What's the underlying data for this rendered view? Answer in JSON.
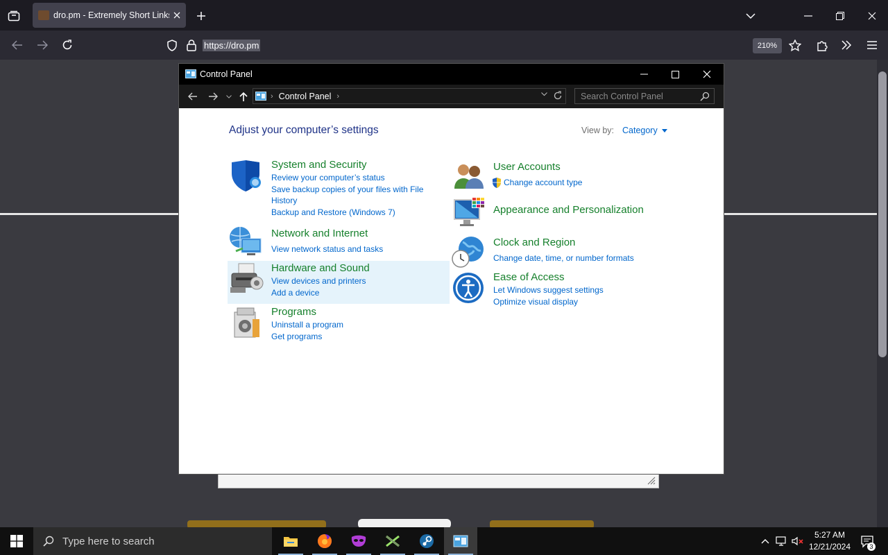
{
  "browser": {
    "tab_title": "dro.pm - Extremely Short Links",
    "url": "https://dro.pm",
    "zoom": "210%"
  },
  "window": {
    "title": "Control Panel",
    "breadcrumb": "Control Panel",
    "search_placeholder": "Search Control Panel"
  },
  "control_panel": {
    "heading": "Adjust your computer’s settings",
    "view_by_label": "View by:",
    "view_by_value": "Category",
    "left": [
      {
        "title": "System and Security",
        "icon": "shield-icon",
        "links": [
          "Review your computer’s status",
          "Save backup copies of your files with File",
          "History",
          "Backup and Restore (Windows 7)"
        ]
      },
      {
        "title": "Network and Internet",
        "icon": "network-icon",
        "links": [
          "View network status and tasks"
        ]
      },
      {
        "title": "Hardware and Sound",
        "icon": "printer-icon",
        "links": [
          "View devices and printers",
          "Add a device"
        ]
      },
      {
        "title": "Programs",
        "icon": "programs-icon",
        "links": [
          "Uninstall a program",
          "Get programs"
        ]
      }
    ],
    "right": [
      {
        "title": "User Accounts",
        "icon": "users-icon",
        "links": [
          "Change account type"
        ]
      },
      {
        "title": "Appearance and Personalization",
        "icon": "monitor-icon",
        "links": []
      },
      {
        "title": "Clock and Region",
        "icon": "globe-clock-icon",
        "links": [
          "Change date, time, or number formats"
        ]
      },
      {
        "title": "Ease of Access",
        "icon": "ease-of-access-icon",
        "links": [
          "Let Windows suggest settings",
          "Optimize visual display"
        ]
      }
    ]
  },
  "taskbar": {
    "search_placeholder": "Type here to search",
    "time": "5:27 AM",
    "date": "12/21/2024",
    "notification_count": "3"
  },
  "colors": {
    "category_title": "#16802c",
    "link": "#0066cc",
    "heading": "#1e3287"
  }
}
